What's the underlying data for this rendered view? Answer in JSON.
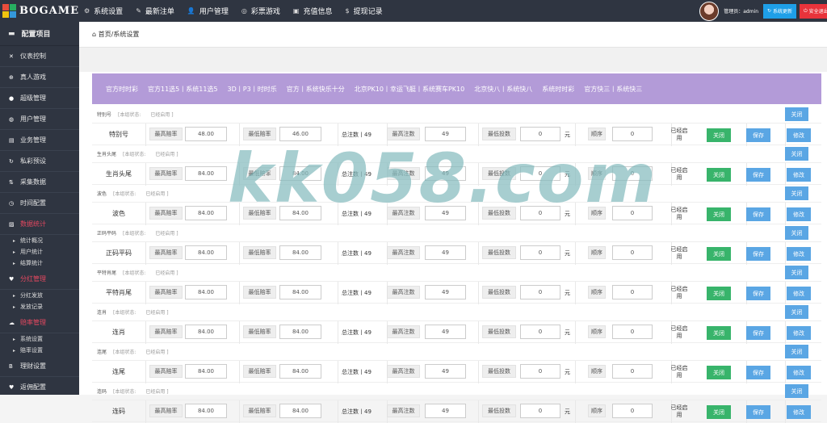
{
  "logo": {
    "text": "BOGAME"
  },
  "topnav": [
    {
      "icon": "gear-icon",
      "glyph": "⚙",
      "label": "系统设置"
    },
    {
      "icon": "wand-icon",
      "glyph": "✎",
      "label": "最新注单"
    },
    {
      "icon": "user-icon",
      "glyph": "👤",
      "label": "用户管理"
    },
    {
      "icon": "bullseye-icon",
      "glyph": "◎",
      "label": "彩票游戏"
    },
    {
      "icon": "coin-icon",
      "glyph": "▣",
      "label": "充值信息"
    },
    {
      "icon": "dollar-icon",
      "glyph": "$",
      "label": "提现记录"
    }
  ],
  "user": {
    "admin_label": "管理员：admin",
    "update_btn": "系统更新",
    "exit_btn": "安全退出"
  },
  "sidebar": {
    "header": "配置项目",
    "items": [
      {
        "glyph": "✕",
        "label": "仪表控制",
        "red": false
      },
      {
        "glyph": "⊕",
        "label": "真人游戏",
        "red": false
      },
      {
        "glyph": "●",
        "label": "超级管理",
        "red": false
      },
      {
        "glyph": "◍",
        "label": "用户管理",
        "red": false
      },
      {
        "glyph": "▤",
        "label": "业务管理",
        "red": false
      },
      {
        "glyph": "↻",
        "label": "私彩预设",
        "red": false
      },
      {
        "glyph": "⇅",
        "label": "采集数据",
        "red": false
      },
      {
        "glyph": "◷",
        "label": "时间配置",
        "red": false
      },
      {
        "glyph": "▨",
        "label": "数据统计",
        "red": true
      }
    ],
    "sub_stats": [
      "统计概况",
      "用户统计",
      "结算统计"
    ],
    "item_share": {
      "glyph": "♥",
      "label": "分红管理"
    },
    "sub_share": [
      "分红发放",
      "发放记录"
    ],
    "item_odds": {
      "glyph": "☁",
      "label": "赔率管理"
    },
    "sub_odds": [
      "系统设置",
      "赔率设置"
    ],
    "item_finance": {
      "glyph": "B",
      "label": "理财设置"
    },
    "item_last": {
      "glyph": "♥",
      "label": "返佣配置"
    }
  },
  "breadcrumb": {
    "home": "首页",
    "sep": " / ",
    "current": "系统设置"
  },
  "tabs": [
    "官方时时彩",
    "官方11选5丨系统11选5",
    "3D丨P3丨时时乐",
    "官方丨系统快乐十分",
    "北京PK10丨幸运飞艇丨系统赛车PK10",
    "北京快八丨系统快八",
    "系统时时彩",
    "官方快三丨系统快三"
  ],
  "labels": {
    "status": "[本组状态:",
    "status_val": "已经启用 ]",
    "max_odds": "最高赔率",
    "min_odds": "最低赔率",
    "max_bet": "最高注数",
    "min_bet_amount": "最低投数",
    "yuan": "元",
    "order": "顺序",
    "enabled": "已经启用",
    "close": "关闭",
    "save": "保存",
    "modify": "修改"
  },
  "rows": [
    {
      "group": "特别号",
      "name": "特别号",
      "max_odds": "48.00",
      "min_odds": "46.00",
      "total": "总注数丨49",
      "max_bet": "49",
      "min_amount": "0",
      "order": "0"
    },
    {
      "group": "生肖头尾",
      "name": "生肖头尾",
      "max_odds": "84.00",
      "min_odds": "84.00",
      "total": "总注数丨49",
      "max_bet": "49",
      "min_amount": "0",
      "order": "0"
    },
    {
      "group": "波色",
      "name": "波色",
      "max_odds": "84.00",
      "min_odds": "84.00",
      "total": "总注数丨49",
      "max_bet": "49",
      "min_amount": "0",
      "order": "0"
    },
    {
      "group": "正码平码",
      "name": "正码平码",
      "max_odds": "84.00",
      "min_odds": "84.00",
      "total": "总注数丨49",
      "max_bet": "49",
      "min_amount": "0",
      "order": "0"
    },
    {
      "group": "平特肖尾",
      "name": "平特肖尾",
      "max_odds": "84.00",
      "min_odds": "84.00",
      "total": "总注数丨49",
      "max_bet": "49",
      "min_amount": "0",
      "order": "0"
    },
    {
      "group": "连肖",
      "name": "连肖",
      "max_odds": "84.00",
      "min_odds": "84.00",
      "total": "总注数丨49",
      "max_bet": "49",
      "min_amount": "0",
      "order": "0"
    },
    {
      "group": "连尾",
      "name": "连尾",
      "max_odds": "84.00",
      "min_odds": "84.00",
      "total": "总注数丨49",
      "max_bet": "49",
      "min_amount": "0",
      "order": "0"
    },
    {
      "group": "连码",
      "name": "连码",
      "max_odds": "84.00",
      "min_odds": "84.00",
      "total": "总注数丨49",
      "max_bet": "49",
      "min_amount": "0",
      "order": "0"
    }
  ],
  "watermark": "kk058.com"
}
